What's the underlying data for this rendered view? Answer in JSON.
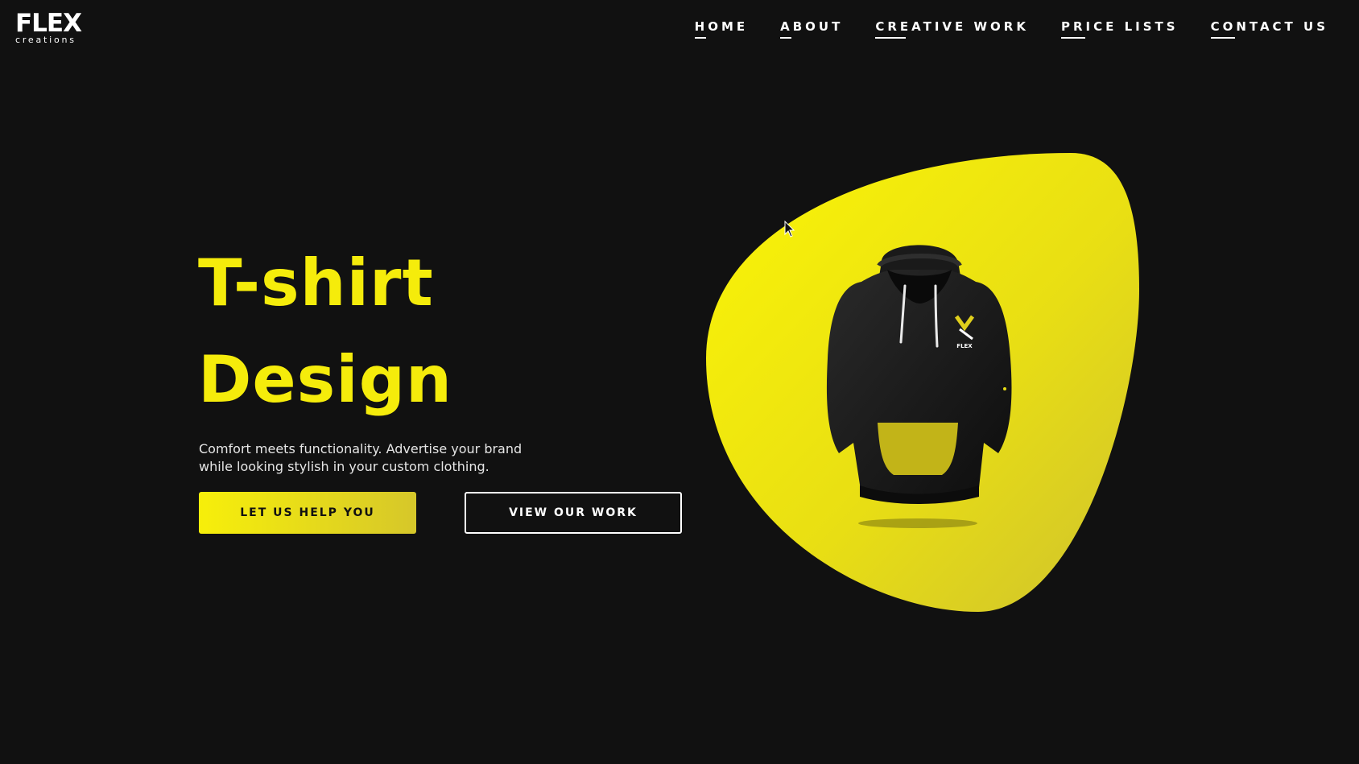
{
  "brand": {
    "logo_main": "FLEX",
    "logo_sub": "creations"
  },
  "nav": {
    "items": [
      {
        "label": "HOME"
      },
      {
        "label": "ABOUT"
      },
      {
        "label": "CREATIVE WORK"
      },
      {
        "label": "PRICE LISTS"
      },
      {
        "label": "CONTACT US"
      }
    ]
  },
  "hero": {
    "title_line1": "T-shirt",
    "title_line2": "Design",
    "description": "Comfort meets functionality. Advertise your brand while looking stylish in your custom clothing.",
    "primary_button": "LET US HELP YOU",
    "secondary_button": "VIEW OUR WORK",
    "hoodie_logo_text": "FLEX"
  },
  "colors": {
    "background": "#111111",
    "accent_yellow": "#f5ec0b",
    "accent_yellow_dark": "#d6c72a",
    "text_white": "#ffffff"
  },
  "icons": {
    "product_image": "black-hoodie-image",
    "cursor": "mouse-pointer-icon"
  }
}
